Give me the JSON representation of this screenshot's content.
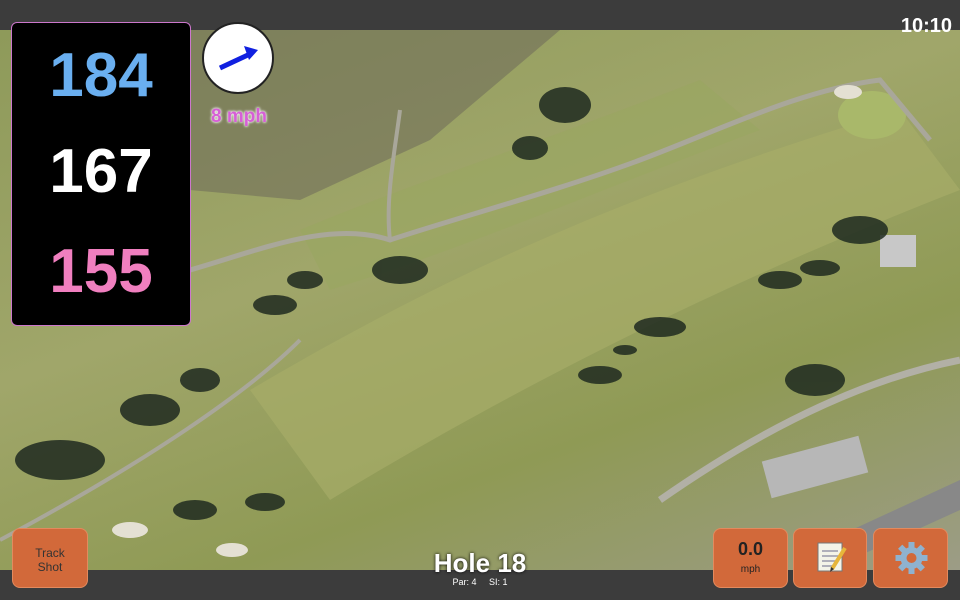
{
  "status_bar": {
    "time": "10:10"
  },
  "distances": {
    "back": "184",
    "middle": "167",
    "front": "155"
  },
  "wind": {
    "speed_label": "8 mph",
    "direction_icon": "arrow-icon"
  },
  "controls": {
    "track_shot_label_line1": "Track",
    "track_shot_label_line2": "Shot",
    "speed_value": "0.0",
    "speed_unit": "mph",
    "notes_icon": "notepad-icon",
    "settings_icon": "gear-icon"
  },
  "hole": {
    "title": "Hole 18",
    "par": "Par: 4",
    "si": "SI: 1"
  },
  "colors": {
    "back": "#6aaff0",
    "middle": "#ffffff",
    "front": "#f07fbf",
    "button": "#d2693a",
    "wind_text": "#d65fd6"
  }
}
